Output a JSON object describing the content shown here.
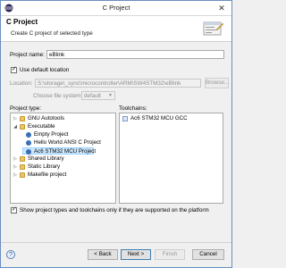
{
  "window": {
    "title": "C Project"
  },
  "banner": {
    "title": "C Project",
    "description": "Create C project of selected type"
  },
  "form": {
    "project_name_label": "Project name:",
    "project_name_value": "eBlink",
    "use_default_location_label": "Use default location",
    "use_default_location_checked": true,
    "location_label": "Location:",
    "location_value": "S:\\storage\\_sync\\microcontroller\\ARM\\SW4STM32\\eBlink",
    "browse_label": "Browse...",
    "choose_fs_label": "Choose file system:",
    "choose_fs_value": "default"
  },
  "project_type": {
    "label": "Project type:",
    "items": [
      {
        "label": "GNU Autotools",
        "expander": "▷",
        "icon": "folder-icon"
      },
      {
        "label": "Executable",
        "expander": "◢",
        "icon": "folder-icon"
      },
      {
        "label": "Empty Project",
        "expander": "",
        "icon": "bullet-icon"
      },
      {
        "label": "Hello World ANSI C Project",
        "expander": "",
        "icon": "bullet-icon"
      },
      {
        "label": "Ac6 STM32 MCU Project",
        "expander": "",
        "icon": "bullet-icon",
        "selected": true
      },
      {
        "label": "Shared Library",
        "expander": "▷",
        "icon": "folder-icon"
      },
      {
        "label": "Static Library",
        "expander": "▷",
        "icon": "folder-icon"
      },
      {
        "label": "Makefile project",
        "expander": "▷",
        "icon": "folder-icon"
      }
    ]
  },
  "toolchains": {
    "label": "Toolchains:",
    "items": [
      {
        "label": "Ac6 STM32 MCU GCC",
        "icon": "toolchain-icon"
      }
    ]
  },
  "show_supported": {
    "label": "Show project types and toolchains only if they are supported on the platform",
    "checked": true
  },
  "buttons": {
    "help": "?",
    "back": "< Back",
    "next": "Next >",
    "finish": "Finish",
    "cancel": "Cancel"
  },
  "colors": {
    "accent": "#3a6fb5",
    "selection": "#cce8ff"
  }
}
